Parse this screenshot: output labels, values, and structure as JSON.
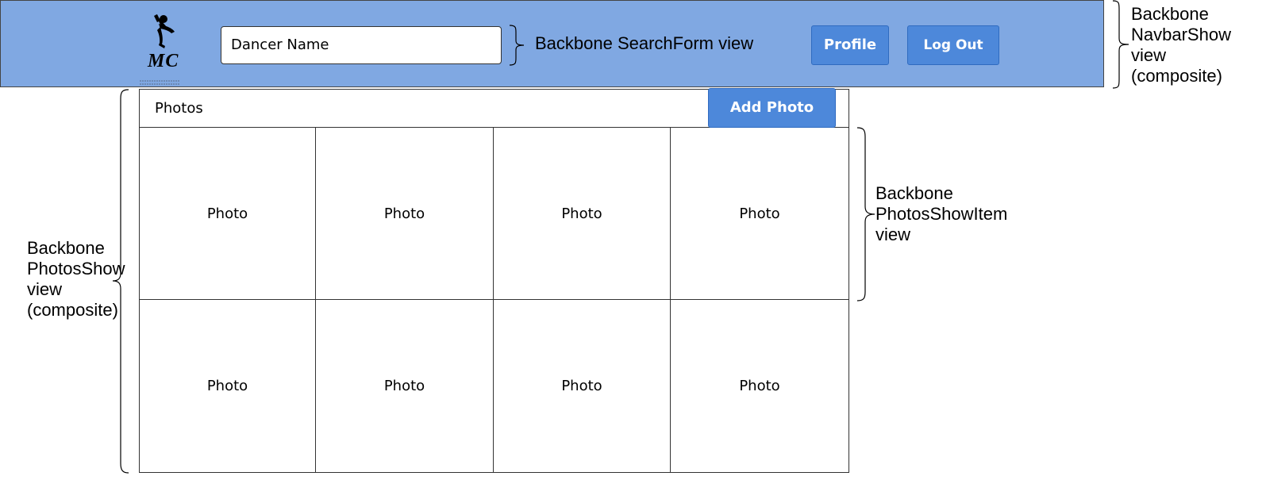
{
  "navbar": {
    "logo_text": "MC",
    "search": {
      "value": "Dancer Name"
    },
    "profile_label": "Profile",
    "logout_label": "Log Out"
  },
  "photos": {
    "title": "Photos",
    "add_label": "Add Photo",
    "items": [
      "Photo",
      "Photo",
      "Photo",
      "Photo",
      "Photo",
      "Photo",
      "Photo",
      "Photo"
    ]
  },
  "annotations": {
    "search_form": "Backbone SearchForm view",
    "navbar_show": [
      "Backbone",
      "NavbarShow",
      "view",
      "(composite)"
    ],
    "photos_show_item": [
      "Backbone",
      "PhotosShowItem",
      "view"
    ],
    "photos_show": [
      "Backbone",
      "PhotosShow",
      "view",
      "(composite)"
    ]
  },
  "colors": {
    "navbar_bg": "#80A8E2",
    "button_bg": "#4D88DA",
    "button_text": "#FFFFFF"
  },
  "icons": {
    "logo": "breakdancer-silhouette-logo"
  }
}
